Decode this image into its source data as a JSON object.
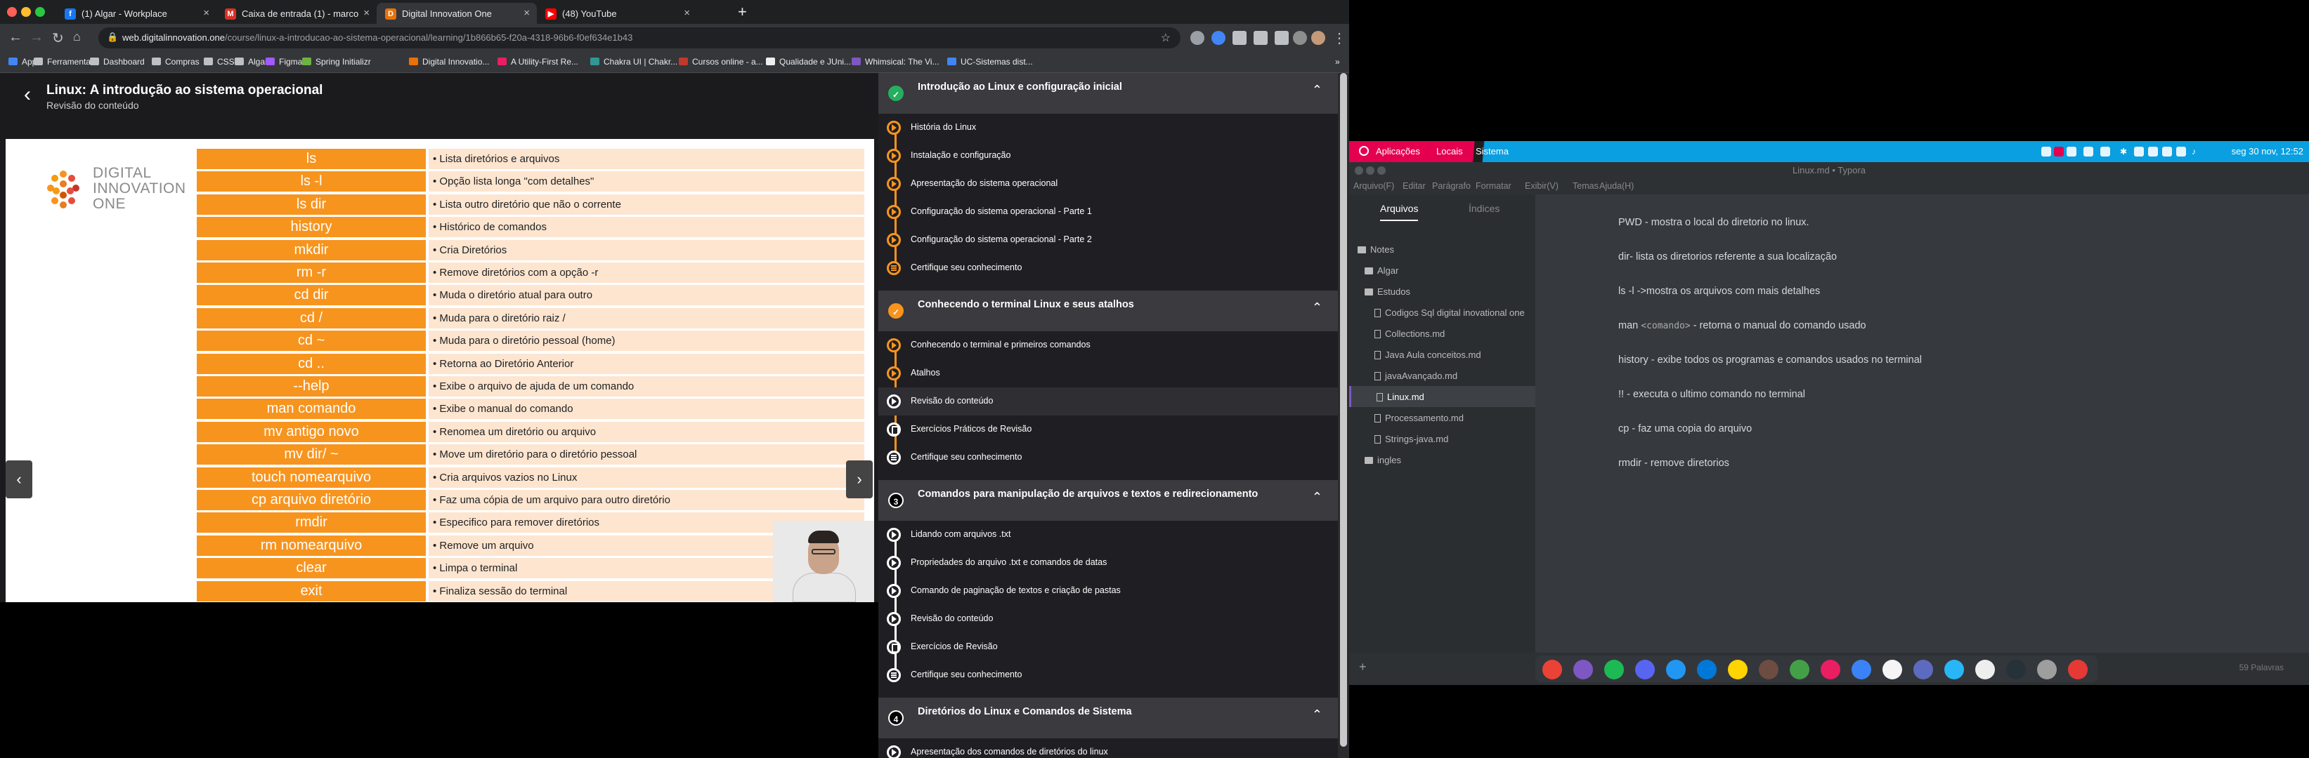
{
  "browser": {
    "tabs": [
      {
        "title": "(1) Algar - Workplace",
        "fav": "f",
        "color": "#1877f2"
      },
      {
        "title": "Caixa de entrada (1) - marco",
        "fav": "M",
        "color": "#d93025"
      },
      {
        "title": "Digital Innovation One",
        "fav": "D",
        "color": "#e8710a"
      },
      {
        "title": "(48) YouTube",
        "fav": "▶",
        "color": "#ff0000"
      }
    ],
    "url_domain": "web.digitalinnovation.one",
    "url_path": "/course/linux-a-introducao-ao-sistema-operacional/learning/1b866b65-f20a-4318-96b6-f0ef634e1b43",
    "bookmarks": [
      {
        "label": "Apps",
        "color": "#4285f4"
      },
      {
        "label": "Ferramentas",
        "color": "#bdc1c6"
      },
      {
        "label": "Dashboard",
        "color": "#bdc1c6"
      },
      {
        "label": "Compras",
        "color": "#bdc1c6"
      },
      {
        "label": "CSS",
        "color": "#bdc1c6"
      },
      {
        "label": "Algar",
        "color": "#bdc1c6"
      },
      {
        "label": "Figma",
        "color": "#a259ff"
      },
      {
        "label": "Spring Initializr",
        "color": "#6db33f"
      },
      {
        "label": "Digital Innovatio...",
        "color": "#e8710a"
      },
      {
        "label": "A Utility-First Re...",
        "color": "#e91e63"
      },
      {
        "label": "Chakra UI | Chakr...",
        "color": "#319795"
      },
      {
        "label": "Cursos online - a...",
        "color": "#c0392b"
      },
      {
        "label": "Qualidade e JUni...",
        "color": "#eeeeee"
      },
      {
        "label": "Whimsical: The Vi...",
        "color": "#7e57c2"
      },
      {
        "label": "UC-Sistemas dist...",
        "color": "#4285f4"
      }
    ]
  },
  "lesson": {
    "title": "Linux: A introdução ao sistema operacional",
    "subtitle": "Revisão do conteúdo"
  },
  "slide": {
    "logo_text": [
      "DIGITAL",
      "INNOVATION",
      "ONE"
    ],
    "rows": [
      {
        "cmd": "ls",
        "desc": "• Lista diretórios e arquivos"
      },
      {
        "cmd": "ls -l",
        "desc": "• Opção lista longa \"com detalhes\""
      },
      {
        "cmd": "ls dir",
        "desc": "• Lista outro diretório que não o corrente"
      },
      {
        "cmd": "history",
        "desc": "• Histórico de comandos"
      },
      {
        "cmd": "mkdir",
        "desc": "• Cria Diretórios"
      },
      {
        "cmd": "rm -r",
        "desc": "• Remove diretórios com a opção -r"
      },
      {
        "cmd": "cd dir",
        "desc": "• Muda o diretório atual para outro"
      },
      {
        "cmd": "cd /",
        "desc": "• Muda para o diretório raiz /"
      },
      {
        "cmd": "cd ~",
        "desc": "• Muda para o diretório pessoal (home)"
      },
      {
        "cmd": "cd ..",
        "desc": "• Retorna ao Diretório Anterior"
      },
      {
        "cmd": "--help",
        "desc": "• Exibe o arquivo de ajuda de um comando"
      },
      {
        "cmd": "man comando",
        "desc": "• Exibe o manual do comando"
      },
      {
        "cmd": "mv antigo novo",
        "desc": "• Renomea um diretório ou arquivo"
      },
      {
        "cmd": "mv  dir/ ~",
        "desc": "• Move um diretório para o diretório pessoal"
      },
      {
        "cmd": "touch nomearquivo",
        "desc": "• Cria arquivos vazios no Linux"
      },
      {
        "cmd": "cp arquivo diretório",
        "desc": "• Faz uma cópia de um arquivo para outro diretório"
      },
      {
        "cmd": "rmdir",
        "desc": "• Especifico para remover diretórios"
      },
      {
        "cmd": "rm nomearquivo",
        "desc": "• Remove um arquivo"
      },
      {
        "cmd": "clear",
        "desc": "• Limpa o terminal"
      },
      {
        "cmd": "exit",
        "desc": "• Finaliza sessão do terminal"
      }
    ]
  },
  "course": {
    "sections": [
      {
        "title": "Introdução ao Linux e configuração inicial",
        "badge": "✓",
        "items": [
          {
            "label": "História do Linux"
          },
          {
            "label": "Instalação e configuração"
          },
          {
            "label": "Apresentação do sistema operacional"
          },
          {
            "label": "Configuração do sistema operacional - Parte 1"
          },
          {
            "label": "Configuração do sistema operacional - Parte 2"
          },
          {
            "label": "Certifique seu conhecimento"
          }
        ]
      },
      {
        "title": "Conhecendo o terminal Linux e seus atalhos",
        "badge": "✓",
        "items": [
          {
            "label": "Conhecendo o terminal e primeiros comandos"
          },
          {
            "label": "Atalhos"
          },
          {
            "label": "Revisão do conteúdo"
          },
          {
            "label": "Exercícios Práticos de Revisão"
          },
          {
            "label": "Certifique seu conhecimento"
          }
        ]
      },
      {
        "title": "Comandos para manipulação de arquivos e textos e redirecionamento",
        "badge": "3",
        "items": [
          {
            "label": "Lidando com arquivos .txt"
          },
          {
            "label": "Propriedades do arquivo .txt e comandos de datas"
          },
          {
            "label": "Comando de paginação de textos e criação de pastas"
          },
          {
            "label": "Revisão do conteúdo"
          },
          {
            "label": "Exercícios de Revisão"
          },
          {
            "label": "Certifique seu conhecimento"
          }
        ]
      },
      {
        "title": "Diretórios do Linux e Comandos de Sistema",
        "badge": "4",
        "items": [
          {
            "label": "Apresentação dos comandos de diretórios do linux"
          }
        ]
      }
    ]
  },
  "desktop": {
    "menus": [
      "Aplicações",
      "Locais",
      "Sistema"
    ],
    "clock": "seg 30 nov, 12:52"
  },
  "typora": {
    "window_title": "Linux.md • Typora",
    "menus": [
      "Arquivo(F)",
      "Editar",
      "Parágrafo",
      "Formatar",
      "Exibir(V)",
      "Temas",
      "Ajuda(H)"
    ],
    "tabs": {
      "files": "Arquivos",
      "outline": "Índices"
    },
    "tree": [
      {
        "label": "Notes",
        "type": "folder"
      },
      {
        "label": "Algar",
        "type": "folder"
      },
      {
        "label": "Estudos",
        "type": "folder"
      },
      {
        "label": "Codigos Sql digital inovational one",
        "type": "file"
      },
      {
        "label": "Collections.md",
        "type": "file"
      },
      {
        "label": "Java Aula conceitos.md",
        "type": "file"
      },
      {
        "label": "javaAvançado.md",
        "type": "file"
      },
      {
        "label": "Linux.md",
        "type": "file"
      },
      {
        "label": "Processamento.md",
        "type": "file"
      },
      {
        "label": "Strings-java.md",
        "type": "file"
      },
      {
        "label": "ingles",
        "type": "folder"
      }
    ],
    "paragraphs": [
      {
        "pre": "PWD - mostra o local do diretorio no linux.",
        "code": "",
        "post": ""
      },
      {
        "pre": "dir- lista os diretorios referente a sua localização",
        "code": "",
        "post": ""
      },
      {
        "pre": "ls -l  ->mostra os arquivos com mais detalhes",
        "code": "",
        "post": ""
      },
      {
        "pre": "man ",
        "code": "<comando>",
        "post": " - retorna o manual do comando usado"
      },
      {
        "pre": "history - exibe todos os programas e comandos usados no terminal",
        "code": "",
        "post": ""
      },
      {
        "pre": "!! - executa o ultimo comando no terminal",
        "code": "",
        "post": ""
      },
      {
        "pre": "cp - faz uma copia do arquivo",
        "code": "",
        "post": ""
      },
      {
        "pre": "rmdir - remove diretorios",
        "code": "",
        "post": ""
      }
    ],
    "word_count": "59 Palavras"
  }
}
